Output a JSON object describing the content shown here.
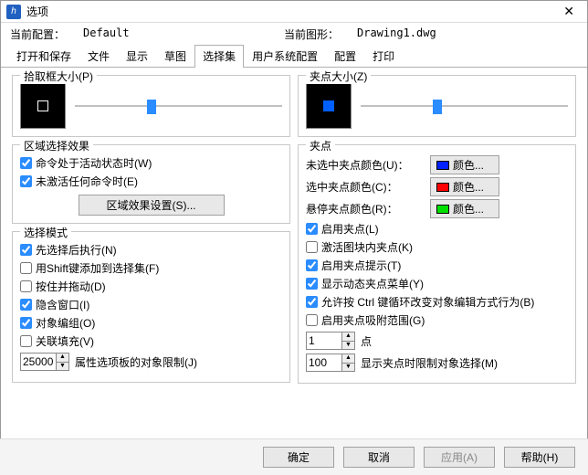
{
  "window": {
    "title": "选项"
  },
  "info": {
    "config_label": "当前配置：",
    "config_value": "Default",
    "drawing_label": "当前图形：",
    "drawing_value": "Drawing1.dwg"
  },
  "tabs": {
    "open_save": "打开和保存",
    "file": "文件",
    "display": "显示",
    "draft": "草图",
    "selection": "选择集",
    "user_sys": "用户系统配置",
    "config": "配置",
    "print": "打印"
  },
  "left": {
    "pickbox_legend": "拾取框大小(P)",
    "region_legend": "区域选择效果",
    "region_chk1": "命令处于活动状态时(W)",
    "region_chk2": "未激活任何命令时(E)",
    "region_btn": "区域效果设置(S)...",
    "mode_legend": "选择模式",
    "mode_chk1": "先选择后执行(N)",
    "mode_chk2": "用Shift键添加到选择集(F)",
    "mode_chk3": "按住并拖动(D)",
    "mode_chk4": "隐含窗口(I)",
    "mode_chk5": "对象编组(O)",
    "mode_chk6": "关联填充(V)",
    "limit_value": "25000",
    "limit_label": "属性选项板的对象限制(J)"
  },
  "right": {
    "gripsize_legend": "夹点大小(Z)",
    "grip_legend": "夹点",
    "c_unsel_label": "未选中夹点颜色(U)：",
    "c_sel_label": "选中夹点颜色(C)：",
    "c_hover_label": "悬停夹点颜色(R)：",
    "color_btn_text": "颜色...",
    "colors": {
      "unselected": "#0020ff",
      "selected": "#ff0000",
      "hover": "#00e000"
    },
    "g_chk1": "启用夹点(L)",
    "g_chk2": "激活图块内夹点(K)",
    "g_chk3": "启用夹点提示(T)",
    "g_chk4": "显示动态夹点菜单(Y)",
    "g_chk5": "允许按 Ctrl 键循环改变对象编辑方式行为(B)",
    "g_chk6": "启用夹点吸附范围(G)",
    "n1_value": "1",
    "n1_label": "点",
    "n2_value": "100",
    "n2_label": "显示夹点时限制对象选择(M)"
  },
  "footer": {
    "ok": "确定",
    "cancel": "取消",
    "apply": "应用(A)",
    "help": "帮助(H)"
  }
}
